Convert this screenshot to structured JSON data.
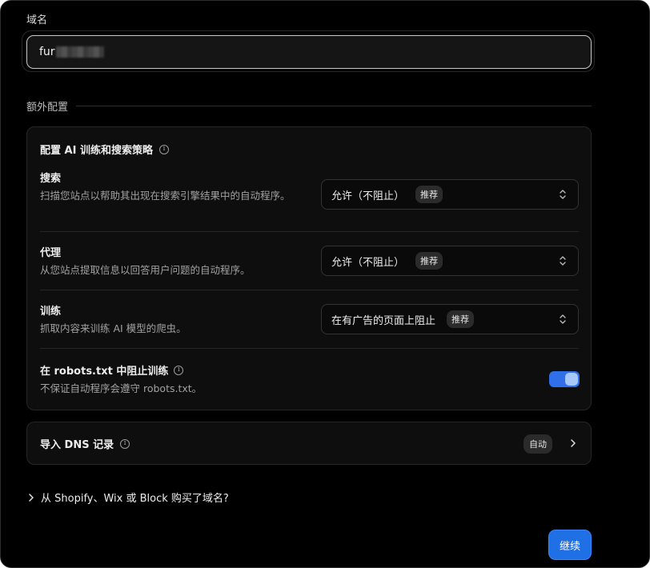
{
  "domain_field": {
    "label": "域名",
    "value_visible": "fur"
  },
  "extra_section": {
    "title": "额外配置"
  },
  "ai_card": {
    "title": "配置 AI 训练和搜索策略",
    "rows": [
      {
        "name": "搜索",
        "desc": "扫描您站点以帮助其出现在搜索引擎结果中的自动程序。",
        "select_value": "允许（不阻止）",
        "badge": "推荐"
      },
      {
        "name": "代理",
        "desc": "从您站点提取信息以回答用户问题的自动程序。",
        "select_value": "允许（不阻止）",
        "badge": "推荐"
      },
      {
        "name": "训练",
        "desc": "抓取内容来训练 AI 模型的爬虫。",
        "select_value": "在有广告的页面上阻止",
        "badge": "推荐"
      }
    ],
    "robots": {
      "name": "在 robots.txt 中阻止训练",
      "desc": "不保证自动程序会遵守 robots.txt。",
      "enabled": true
    }
  },
  "dns_card": {
    "label": "导入 DNS 记录",
    "badge": "自动"
  },
  "shopify_link": "从 Shopify、Wix 或 Block 购买了域名?",
  "continue_button": "继续",
  "colors": {
    "background": "#000000",
    "card": "#0e0e0e",
    "accent": "#1f6fe5",
    "toggle_on": "#2f6fea"
  }
}
